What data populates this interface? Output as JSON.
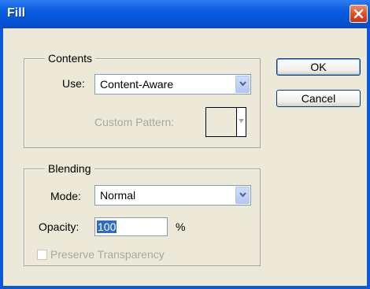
{
  "window": {
    "title": "Fill"
  },
  "contents": {
    "group_label": "Contents",
    "use_label": "Use:",
    "use_value": "Content-Aware",
    "custom_pattern_label": "Custom Pattern:"
  },
  "blending": {
    "group_label": "Blending",
    "mode_label": "Mode:",
    "mode_value": "Normal",
    "opacity_label": "Opacity:",
    "opacity_value": "100",
    "opacity_unit": "%",
    "preserve_label": "Preserve Transparency",
    "preserve_checked": false
  },
  "buttons": {
    "ok": "OK",
    "cancel": "Cancel"
  },
  "colors": {
    "titlebar": "#0554d6",
    "dialog_bg": "#ece9d8",
    "selection": "#316ac5",
    "close": "#de4a22"
  },
  "icons": {
    "close": "close-icon",
    "dropdown": "chevron-down-icon"
  }
}
